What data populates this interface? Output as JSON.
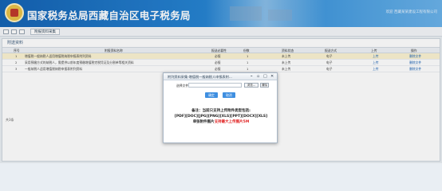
{
  "header": {
    "title": "国家税务总局西藏自治区电子税务局",
    "user_info": "欢迎 西藏某某建设工程有限公司"
  },
  "toolbar": {
    "tab_label": "附报资料采集"
  },
  "panel": {
    "title": "附送资料",
    "columns": [
      "序号",
      "附报资料名称",
      "报送必要性",
      "份数",
      "资料状态",
      "报送方式",
      "上传",
      "操作"
    ],
    "rows": [
      {
        "no": "1",
        "name": "增值税一般纳税人适用增值税纳税申报表附列资料",
        "necessity": "必报",
        "count": "1",
        "status": "未上传",
        "method": "电子",
        "upload": "上传",
        "action": "删除文件"
      },
      {
        "no": "2",
        "name": "采用预缴方式的纳税人，需提供以前年度预缴增值税完税凭证及分割单等相关资料",
        "necessity": "必报",
        "count": "1",
        "status": "未上传",
        "method": "电子",
        "upload": "上传",
        "action": "删除文件"
      },
      {
        "no": "3",
        "name": "一般纳税人适用增值税纳税申报表附列资料",
        "necessity": "必报",
        "count": "1",
        "status": "未上传",
        "method": "电子",
        "upload": "上传",
        "action": "删除文件"
      }
    ],
    "pager_text": "共3条"
  },
  "modal": {
    "title": "附列资料采集-增值税一般纳税人申报表附...",
    "file_label": "选择文件",
    "file_value": "",
    "browse_label": "浏览...",
    "clear_label": "清除",
    "confirm_label": "确定",
    "cancel_label": "取消",
    "note_line1": "备注：当前只支持上传附件类型包括:",
    "note_line2": "[PDF][DOC][JPG][PNG][XLS][PPT][DOCX][XLS]",
    "note_line3_prefix": "单张附件图片",
    "note_line3_red": "支持最大上传图片5M"
  }
}
